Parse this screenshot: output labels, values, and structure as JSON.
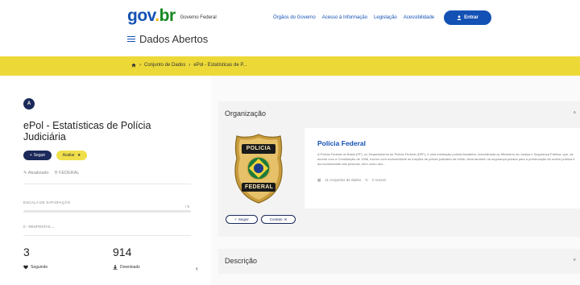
{
  "header": {
    "logo_parts": [
      "go",
      "v",
      ".",
      "br"
    ],
    "logo_subtitle": "Governo Federal",
    "site_title": "Dados Abertos",
    "links": [
      "Órgãos do Governo",
      "Acesso à Informação",
      "Legislação",
      "Acessibilidade"
    ],
    "login_label": "Entrar"
  },
  "breadcrumb": {
    "items": [
      "Conjunto de Dados",
      "ePol - Estatísticas de P..."
    ]
  },
  "dataset": {
    "org_initial": "A",
    "title": "ePol - Estatísticas de Polícia Judiciária",
    "follow_label": "Seguir",
    "rate_label": "Avaliar",
    "updated": "Atualizado",
    "location": "FEDERAL",
    "satisfaction_label": "ESCALA DE SATISFAÇÃO",
    "satisfaction_value": "/ 5",
    "responses": "0 - RESPOSTAS",
    "followers_count": "3",
    "followers_label": "Seguindo",
    "downloads_count": "914",
    "downloads_label": "Downloads"
  },
  "organization": {
    "section_title": "Organização",
    "name": "Polícia Federal",
    "badge_text_top": "POLICIA",
    "badge_text_bottom": "FEDERAL",
    "description": "A Polícia Federal do Brasil (PF), ou Departamento de Polícia Federal (DPF), é uma instituição policial brasileira, subordinada ao Ministério da Justiça e Segurança Pública, que, de acordo com a Constituição de 1988, exerce com exclusividade as funções de polícia judiciária da União. Atua também na segurança pública para a preservação da ordem pública e da incolumidade das pessoas, bem como dos...",
    "datasets_count": "11 conjuntos de dados",
    "reuses_count": "0 reusos",
    "follow_label": "Seguir",
    "contact_label": "Contato"
  },
  "description_section": {
    "title": "Descrição"
  },
  "colors": {
    "primary": "#1351b4",
    "navy": "#1b2a5a",
    "yellow": "#ecd938"
  }
}
